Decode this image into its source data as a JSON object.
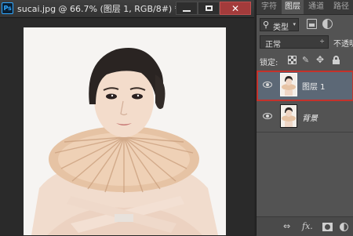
{
  "app": {
    "logo": "Ps"
  },
  "document": {
    "title": "sucai.jpg @ 66.7% (图层 1, RGB/8#) *",
    "window_buttons": [
      "minimize-icon",
      "maximize-icon",
      "close-icon"
    ],
    "close_glyph": "✕"
  },
  "panel": {
    "tabs": [
      {
        "label": "字符",
        "active": false
      },
      {
        "label": "图层",
        "active": true
      },
      {
        "label": "通道",
        "active": false
      },
      {
        "label": "路径",
        "active": false
      }
    ],
    "filter": {
      "icon": "⚲",
      "label": "类型",
      "arrow": "▾"
    },
    "blend_mode": {
      "label": "正常",
      "arrow": "÷"
    },
    "opacity_label": "不透明度:",
    "lock_label": "锁定:",
    "layers": [
      {
        "name": "图层 1",
        "selected": true,
        "visible": true
      },
      {
        "name": "背景",
        "selected": false,
        "visible": true
      }
    ],
    "footer": {
      "link": "⇔",
      "fx": "fx."
    }
  },
  "colors": {
    "app_background": "#262626",
    "panel_background": "#535353",
    "selected_layer": "#5c6876",
    "selection_outline": "#c4322b",
    "close_button": "#a33b3b",
    "ps_blue": "#31a8ff"
  }
}
